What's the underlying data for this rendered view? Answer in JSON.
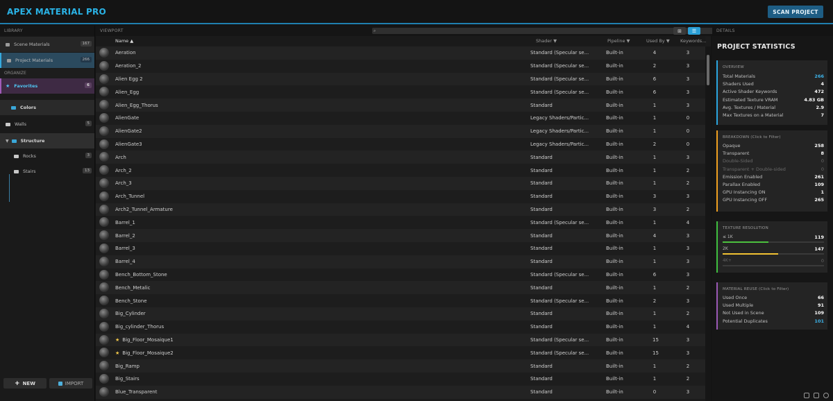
{
  "app": {
    "title": "APEX MATERIAL PRO",
    "scan_label": "SCAN PROJECT"
  },
  "library": {
    "head": "LIBRARY",
    "items": [
      {
        "label": "Scene Materials",
        "count": "167"
      },
      {
        "label": "Project Materials",
        "count": "266"
      }
    ],
    "organize": "ORGANIZE",
    "favorites": {
      "label": "Favorites",
      "count": "6"
    },
    "folders": {
      "colors": "Colors",
      "walls": {
        "label": "Walls",
        "count": "5"
      },
      "structure": "Structure",
      "rocks": {
        "label": "Rocks",
        "count": "3"
      },
      "stairs": {
        "label": "Stairs",
        "count": "13"
      }
    },
    "new_label": "NEW",
    "import_label": "IMPORT"
  },
  "viewport": {
    "head": "VIEWPORT",
    "columns": {
      "name": "Name ▲",
      "shader": "Shader ▼",
      "pipeline": "Pipeline ▼",
      "used_by": "Used By ▼",
      "keywords": "Keywords..."
    },
    "rows": [
      {
        "name": "Aeration",
        "shader": "Standard (Specular se...",
        "pipeline": "Built-in",
        "used": "4",
        "kw": "3",
        "star": false
      },
      {
        "name": "Aeration_2",
        "shader": "Standard (Specular se...",
        "pipeline": "Built-in",
        "used": "2",
        "kw": "3",
        "star": false
      },
      {
        "name": "Alien Egg 2",
        "shader": "Standard (Specular se...",
        "pipeline": "Built-in",
        "used": "6",
        "kw": "3",
        "star": false
      },
      {
        "name": "Alien_Egg",
        "shader": "Standard (Specular se...",
        "pipeline": "Built-in",
        "used": "6",
        "kw": "3",
        "star": false
      },
      {
        "name": "Alien_Egg_Thorus",
        "shader": "Standard",
        "pipeline": "Built-in",
        "used": "1",
        "kw": "3",
        "star": false
      },
      {
        "name": "AlienGate",
        "shader": "Legacy Shaders/Partic...",
        "pipeline": "Built-in",
        "used": "1",
        "kw": "0",
        "star": false
      },
      {
        "name": "AlienGate2",
        "shader": "Legacy Shaders/Partic...",
        "pipeline": "Built-in",
        "used": "1",
        "kw": "0",
        "star": false
      },
      {
        "name": "AlienGate3",
        "shader": "Legacy Shaders/Partic...",
        "pipeline": "Built-in",
        "used": "2",
        "kw": "0",
        "star": false
      },
      {
        "name": "Arch",
        "shader": "Standard",
        "pipeline": "Built-in",
        "used": "1",
        "kw": "3",
        "star": false
      },
      {
        "name": "Arch_2",
        "shader": "Standard",
        "pipeline": "Built-in",
        "used": "1",
        "kw": "2",
        "star": false
      },
      {
        "name": "Arch_3",
        "shader": "Standard",
        "pipeline": "Built-in",
        "used": "1",
        "kw": "2",
        "star": false
      },
      {
        "name": "Arch_Tunnel",
        "shader": "Standard",
        "pipeline": "Built-in",
        "used": "3",
        "kw": "3",
        "star": false
      },
      {
        "name": "Arch2_Tunnel_Armature",
        "shader": "Standard",
        "pipeline": "Built-in",
        "used": "3",
        "kw": "2",
        "star": false
      },
      {
        "name": "Barrel_1",
        "shader": "Standard (Specular se...",
        "pipeline": "Built-in",
        "used": "1",
        "kw": "4",
        "star": false
      },
      {
        "name": "Barrel_2",
        "shader": "Standard",
        "pipeline": "Built-in",
        "used": "4",
        "kw": "3",
        "star": false
      },
      {
        "name": "Barrel_3",
        "shader": "Standard",
        "pipeline": "Built-in",
        "used": "1",
        "kw": "3",
        "star": false
      },
      {
        "name": "Barrel_4",
        "shader": "Standard",
        "pipeline": "Built-in",
        "used": "1",
        "kw": "3",
        "star": false
      },
      {
        "name": "Bench_Bottom_Stone",
        "shader": "Standard (Specular se...",
        "pipeline": "Built-in",
        "used": "6",
        "kw": "3",
        "star": false
      },
      {
        "name": "Bench_Metalic",
        "shader": "Standard",
        "pipeline": "Built-in",
        "used": "1",
        "kw": "2",
        "star": false
      },
      {
        "name": "Bench_Stone",
        "shader": "Standard (Specular se...",
        "pipeline": "Built-in",
        "used": "2",
        "kw": "3",
        "star": false
      },
      {
        "name": "Big_Cylinder",
        "shader": "Standard",
        "pipeline": "Built-in",
        "used": "1",
        "kw": "2",
        "star": false
      },
      {
        "name": "Big_cylinder_Thorus",
        "shader": "Standard",
        "pipeline": "Built-in",
        "used": "1",
        "kw": "4",
        "star": false
      },
      {
        "name": "Big_Floor_Mosaique1",
        "shader": "Standard (Specular se...",
        "pipeline": "Built-in",
        "used": "15",
        "kw": "3",
        "star": true
      },
      {
        "name": "Big_Floor_Mosaique2",
        "shader": "Standard (Specular se...",
        "pipeline": "Built-in",
        "used": "15",
        "kw": "3",
        "star": true
      },
      {
        "name": "Big_Ramp",
        "shader": "Standard",
        "pipeline": "Built-in",
        "used": "1",
        "kw": "2",
        "star": false
      },
      {
        "name": "Big_Stairs",
        "shader": "Standard",
        "pipeline": "Built-in",
        "used": "1",
        "kw": "2",
        "star": false
      },
      {
        "name": "Blue_Transparent",
        "shader": "Standard",
        "pipeline": "Built-in",
        "used": "0",
        "kw": "3",
        "star": false
      }
    ]
  },
  "details": {
    "head": "DETAILS",
    "title": "PROJECT STATISTICS",
    "overview": {
      "title": "OVERVIEW",
      "items": [
        {
          "k": "Total Materials",
          "v": "266",
          "blue": true
        },
        {
          "k": "Shaders Used",
          "v": "4"
        },
        {
          "k": "Active Shader Keywords",
          "v": "472"
        },
        {
          "k": "Estimated Texture VRAM",
          "v": "4.83 GB"
        },
        {
          "k": "Avg. Textures / Material",
          "v": "2.9"
        },
        {
          "k": "Max Textures on a Material",
          "v": "7"
        }
      ]
    },
    "breakdown": {
      "title": "BREAKDOWN (Click to Filter)",
      "items": [
        {
          "k": "Opaque",
          "v": "258"
        },
        {
          "k": "Transparent",
          "v": "8"
        },
        {
          "k": "Double-Sided",
          "v": "0",
          "dim": true
        },
        {
          "k": "Transparent + Double-sided",
          "v": "0",
          "dim": true
        },
        {
          "k": "Emission Enabled",
          "v": "261"
        },
        {
          "k": "Parallax Enabled",
          "v": "109"
        },
        {
          "k": "GPU Instancing ON",
          "v": "1"
        },
        {
          "k": "GPU Instancing OFF",
          "v": "265"
        }
      ]
    },
    "texture": {
      "title": "TEXTURE RESOLUTION",
      "items": [
        {
          "k": "≤ 1K",
          "v": "119",
          "fraction": 0.45,
          "color": "#4cc23f"
        },
        {
          "k": "2K",
          "v": "147",
          "fraction": 0.55,
          "color": "#f1c232"
        },
        {
          "k": "4K+",
          "v": "0",
          "fraction": 0,
          "color": "#666666",
          "dim": true
        }
      ]
    },
    "reuse": {
      "title": "MATERIAL REUSE (Click to Filter)",
      "items": [
        {
          "k": "Used Once",
          "v": "66"
        },
        {
          "k": "Used Multiple",
          "v": "91"
        },
        {
          "k": "Not Used in Scene",
          "v": "109"
        },
        {
          "k": "Potential Duplicates",
          "v": "101",
          "blue": true
        }
      ]
    }
  },
  "colors": {
    "accent": "#2ab3e6",
    "overview": "#2aa6e0",
    "breakdown": "#f0a020",
    "texture": "#3fbf3f",
    "reuse": "#9b59b6"
  }
}
